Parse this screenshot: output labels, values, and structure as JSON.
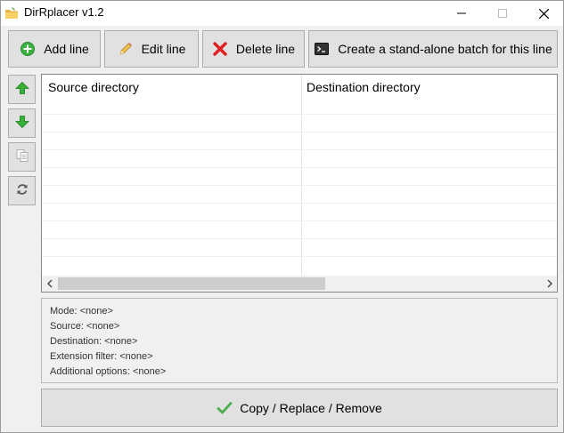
{
  "window": {
    "title": "DirRplacer v1.2"
  },
  "toolbar": {
    "add_label": "Add line",
    "edit_label": "Edit line",
    "delete_label": "Delete line",
    "batch_label": "Create a stand-alone batch for this line"
  },
  "side_buttons": [
    {
      "icon": "arrow-up-icon"
    },
    {
      "icon": "arrow-down-icon"
    },
    {
      "icon": "copy-icon"
    },
    {
      "icon": "refresh-icon"
    }
  ],
  "list": {
    "columns": [
      "Source directory",
      "Destination directory"
    ],
    "rows": []
  },
  "info": {
    "mode": "Mode: <none>",
    "source": "Source: <none>",
    "destination": "Destination: <none>",
    "extension_filter": "Extension filter: <none>",
    "additional_options": "Additional options: <none>"
  },
  "action": {
    "label": "Copy / Replace / Remove"
  },
  "colors": {
    "add_icon": "#3cb043",
    "delete_icon": "#e02020",
    "arrow_icon": "#2fa52f",
    "check_icon": "#4caf50"
  }
}
